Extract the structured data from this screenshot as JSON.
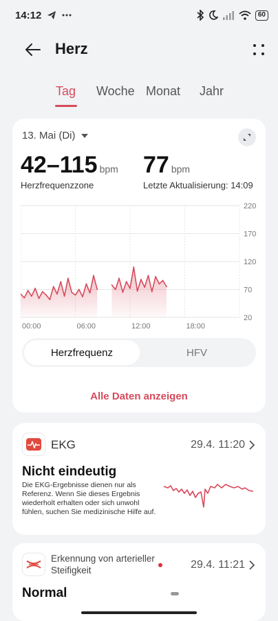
{
  "status_bar": {
    "time": "14:12",
    "left_icons": [
      "telegram-icon",
      "more-dots-icon"
    ],
    "right_icons": [
      "bluetooth-icon",
      "moon-icon",
      "signal-icon",
      "wifi-icon"
    ],
    "battery": "60"
  },
  "header": {
    "title": "Herz"
  },
  "tabs": [
    {
      "label": "Tag",
      "active": true
    },
    {
      "label": "Woche",
      "active": false
    },
    {
      "label": "Monat",
      "active": false
    },
    {
      "label": "Jahr",
      "active": false
    }
  ],
  "summary": {
    "date": "13. Mai (Di)",
    "range_value": "42–115",
    "range_unit": "bpm",
    "range_label": "Herzfrequenzzone",
    "latest_value": "77",
    "latest_unit": "bpm",
    "latest_label": "Letzte Aktualisierung: 14:09"
  },
  "chart_data": {
    "type": "line",
    "x_ticks": [
      "00:00",
      "06:00",
      "12:00",
      "18:00"
    ],
    "y_ticks": [
      220,
      170,
      120,
      70,
      20
    ],
    "ylim": [
      20,
      220
    ],
    "xlim": [
      0,
      24
    ],
    "line_color": "#d64b5c",
    "series": [
      {
        "x": [
          0.0,
          0.4,
          0.8,
          1.2,
          1.6,
          2.0,
          2.4,
          2.8,
          3.2,
          3.6,
          4.0,
          4.4,
          4.8,
          5.2,
          5.6,
          6.0,
          6.4,
          6.8,
          7.2,
          7.6,
          8.0,
          8.4
        ],
        "y": [
          62,
          55,
          68,
          58,
          72,
          54,
          66,
          60,
          52,
          75,
          62,
          84,
          58,
          90,
          65,
          60,
          70,
          57,
          80,
          64,
          95,
          70
        ]
      },
      {
        "x": [
          10.0,
          10.4,
          10.8,
          11.2,
          11.6,
          12.0,
          12.4,
          12.8,
          13.2,
          13.6,
          14.0,
          14.4,
          14.8,
          15.2,
          15.6,
          16.0
        ],
        "y": [
          78,
          70,
          90,
          65,
          84,
          72,
          110,
          67,
          88,
          74,
          95,
          66,
          93,
          80,
          86,
          75
        ]
      }
    ]
  },
  "segment": {
    "tab1": "Herzfrequenz",
    "tab2": "HFV"
  },
  "all_data_label": "Alle Daten anzeigen",
  "ekg": {
    "title": "EKG",
    "time": "29.4. 11:20",
    "result": "Nicht eindeutig",
    "description": "Die EKG-Ergebnisse dienen nur als Referenz. Wenn Sie dieses Ergebnis wiederholt erhalten oder sich unwohl fühlen, suchen Sie medizinische Hilfe auf."
  },
  "arterial": {
    "title_line1": "Erkennung von arterieller",
    "title_line2": "Steifigkeit",
    "time": "29.4. 11:21",
    "result": "Normal"
  }
}
